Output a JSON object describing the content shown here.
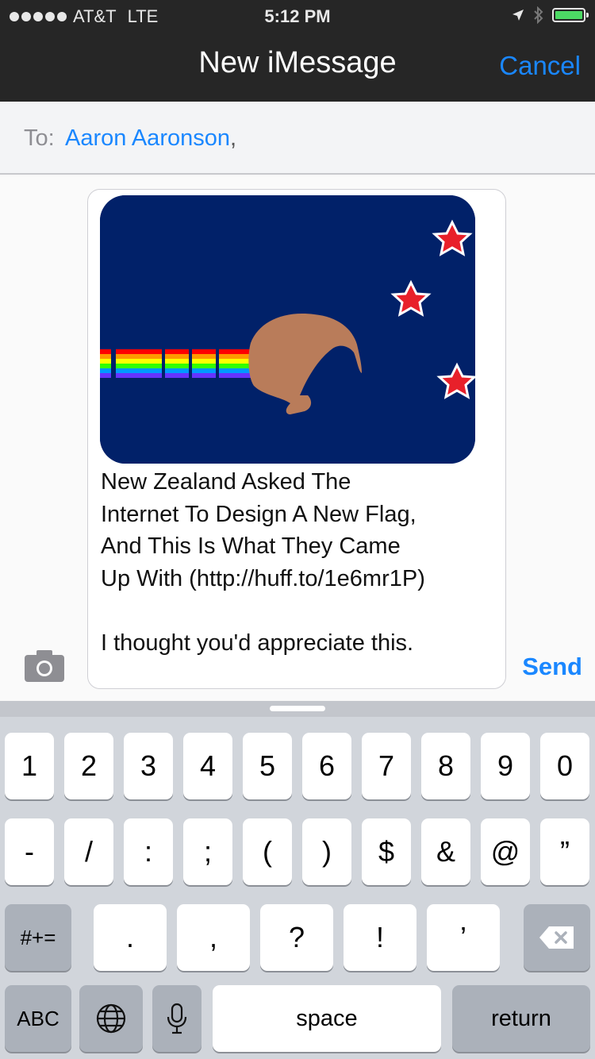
{
  "status_bar": {
    "carrier": "AT&T",
    "network": "LTE",
    "time": "5:12 PM"
  },
  "nav": {
    "title": "New iMessage",
    "cancel_label": "Cancel"
  },
  "to_field": {
    "label": "To:",
    "recipient": "Aaron Aaronson",
    "separator": ","
  },
  "message": {
    "text": "New Zealand Asked The\nInternet To Design A New Flag,\nAnd This Is What They Came\nUp With (http://huff.to/1e6mr1P)\n\nI thought you'd appreciate this.",
    "send_label": "Send"
  },
  "keyboard": {
    "row1": [
      "1",
      "2",
      "3",
      "4",
      "5",
      "6",
      "7",
      "8",
      "9",
      "0"
    ],
    "row2": [
      "-",
      "/",
      ":",
      ";",
      "(",
      ")",
      "$",
      "&",
      "@",
      "”"
    ],
    "shift_label": "#+=",
    "row3": [
      ".",
      ",",
      "?",
      "!",
      "’"
    ],
    "abc_label": "ABC",
    "space_label": "space",
    "return_label": "return"
  },
  "colors": {
    "accent": "#1a87ff",
    "flag_blue": "#012169",
    "star_red": "#e8202a",
    "kiwi_brown": "#b97c5a",
    "battery_green": "#4cd964"
  }
}
